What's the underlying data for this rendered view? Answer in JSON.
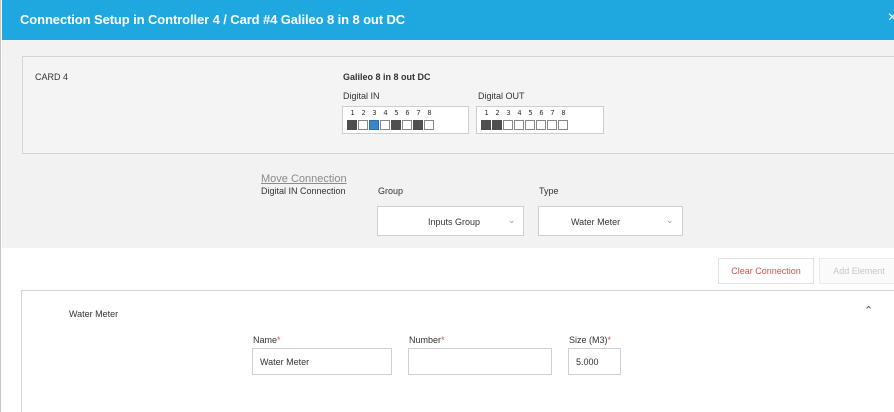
{
  "dialog": {
    "title": "Connection Setup in Controller 4 / Card #4 Galileo 8 in 8 out DC",
    "close_glyph": "×"
  },
  "card": {
    "label": "CARD 4",
    "model": "Galileo 8 in 8 out DC",
    "digital_in": {
      "label": "Digital IN",
      "numbers": [
        "1",
        "2",
        "3",
        "4",
        "5",
        "6",
        "7",
        "8"
      ],
      "states": [
        "dark",
        "empty",
        "selected",
        "empty",
        "dark",
        "empty",
        "dark",
        "empty"
      ]
    },
    "digital_out": {
      "label": "Digital OUT",
      "numbers": [
        "1",
        "2",
        "3",
        "4",
        "5",
        "6",
        "7",
        "8"
      ],
      "states": [
        "dark",
        "dark",
        "empty",
        "empty",
        "empty",
        "empty",
        "empty",
        "empty"
      ]
    }
  },
  "connection": {
    "section_label": "Digital IN Connection",
    "move_link": "Move Connection",
    "group_label": "Group",
    "group_value": "Inputs Group",
    "type_label": "Type",
    "type_value": "Water Meter"
  },
  "actions": {
    "clear": "Clear Connection",
    "add": "Add Element"
  },
  "element": {
    "title": "Water Meter",
    "name_label": "Name",
    "name_value": "Water Meter",
    "number_label": "Number",
    "number_value": "",
    "size_label": "Size (M3)",
    "size_value": "5.000",
    "required_mark": "*"
  },
  "colors": {
    "titlebar": "#1fa7e0",
    "selected_port": "#3a86c9",
    "active_port": "#4f4f4f",
    "danger": "#d9534f"
  }
}
